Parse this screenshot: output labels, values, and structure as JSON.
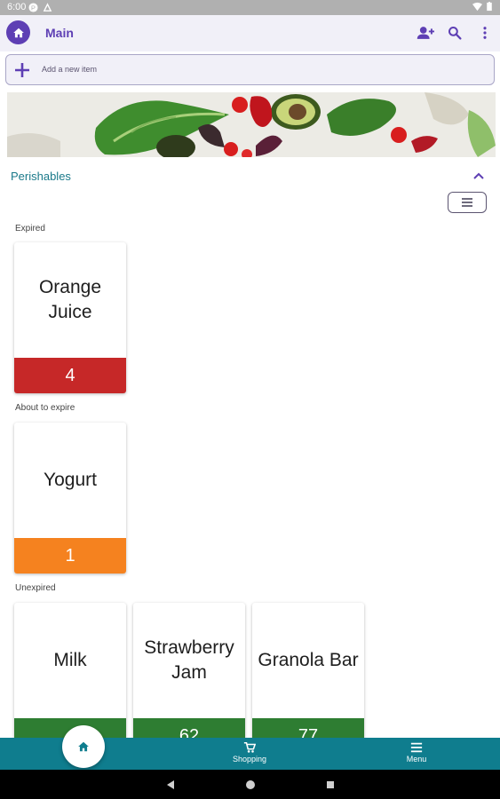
{
  "status_bar": {
    "time": "6:00"
  },
  "app_bar": {
    "title": "Main"
  },
  "add_item": {
    "label": "Add a new item"
  },
  "section": {
    "title": "Perishables"
  },
  "groups": {
    "expired": {
      "label": "Expired"
    },
    "about_to_expire": {
      "label": "About to expire"
    },
    "unexpired": {
      "label": "Unexpired"
    }
  },
  "items": {
    "orange_juice": {
      "name": "Orange Juice",
      "count": "4"
    },
    "yogurt": {
      "name": "Yogurt",
      "count": "1"
    },
    "milk": {
      "name": "Milk",
      "count": ""
    },
    "strawberry_jam": {
      "name": "Strawberry Jam",
      "count": "62"
    },
    "granola_bar": {
      "name": "Granola Bar",
      "count": "77"
    }
  },
  "bottom_nav": {
    "home": {
      "label": ""
    },
    "shopping": {
      "label": "Shopping"
    },
    "menu": {
      "label": "Menu"
    }
  },
  "colors": {
    "primary": "#5e3fb4",
    "teal": "#0f7d8e",
    "expired": "#c62828",
    "about_to_expire": "#f5821f",
    "unexpired": "#2e7d32"
  }
}
